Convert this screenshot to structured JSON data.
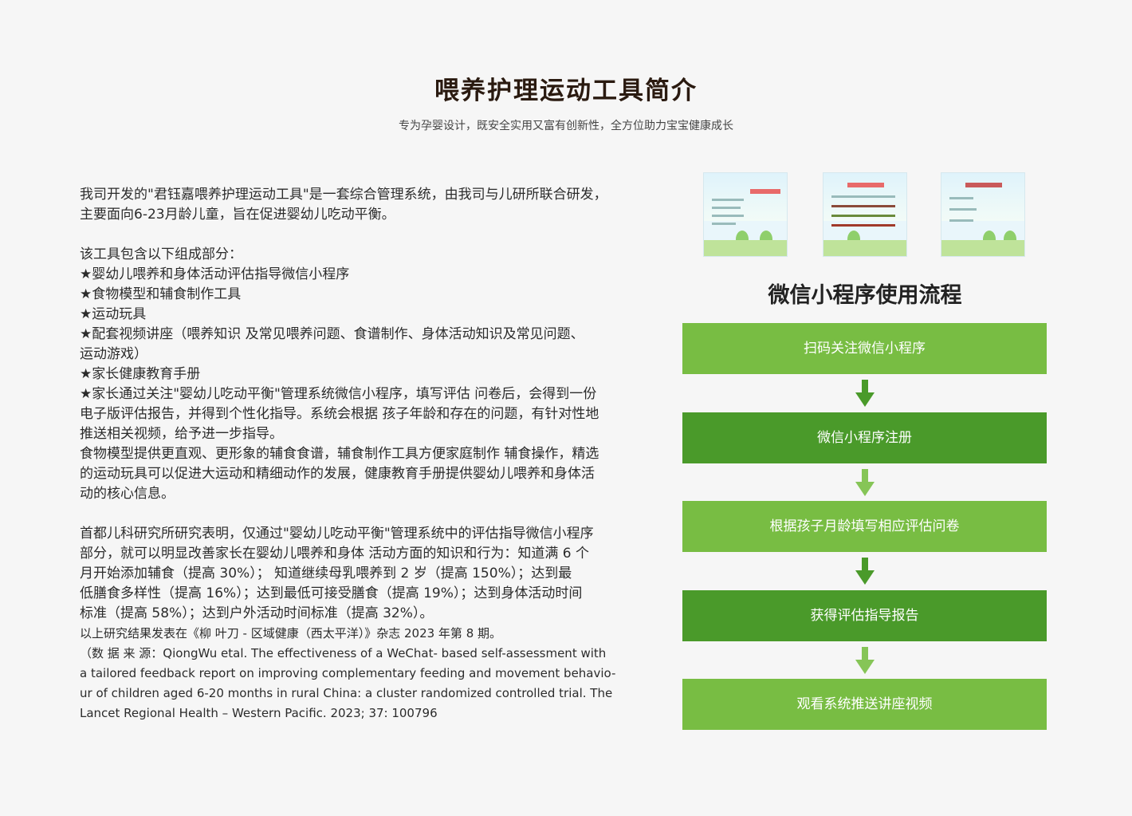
{
  "header": {
    "title": "喂养护理运动工具简介",
    "subtitle": "专为孕婴设计，既安全实用又富有创新性，全方位助力宝宝健康成长"
  },
  "intro": {
    "p1_line1": "我司开发的\"君钰嘉喂养护理运动工具\"是一套综合管理系统，由我司与儿研所联合研发，",
    "p1_line2": "主要面向6-23月龄儿童，旨在促进婴幼儿吃动平衡。",
    "components_heading": "该工具包含以下组成部分：",
    "item1": "★婴幼儿喂养和身体活动评估指导微信小程序",
    "item2": "★食物模型和辅食制作工具",
    "item3": "★运动玩具",
    "item4_line1": "★配套视频讲座（喂养知识  及常见喂养问题、食谱制作、身体活动知识及常见问题、",
    "item4_line2": "运动游戏）",
    "item5": "★家长健康教育手册",
    "item6_line1": "★家长通过关注\"婴幼儿吃动平衡\"管理系统微信小程序，填写评估 问卷后，会得到一份",
    "item6_line2": "电子版评估报告，并得到个性化指导。系统会根据 孩子年龄和存在的问题，有针对性地",
    "item6_line3": "推送相关视频，给予进一步指导。",
    "p2_line1": "食物模型提供更直观、更形象的辅食食谱，辅食制作工具方便家庭制作 辅食操作，精选",
    "p2_line2": "的运动玩具可以促进大运动和精细动作的发展，健康教育手册提供婴幼儿喂养和身体活",
    "p2_line3": "动的核心信息。"
  },
  "research": {
    "line1": "首都儿科研究所研究表明，仅通过\"婴幼儿吃动平衡\"管理系统中的评估指导微信小程序",
    "line2": "部分，就可以明显改善家长在婴幼儿喂养和身体 活动方面的知识和行为：知道满 6 个",
    "line3": "月开始添加辅食（提高 30%）；  知道继续母乳喂养到 2 岁（提高 150%）；达到最",
    "line4": "低膳食多样性（提高 16%）；达到最低可接受膳食（提高 19%）；达到身体活动时间",
    "line5": "标准（提高 58%）；达到户外活动时间标准（提高 32%）。",
    "publication": "以上研究结果发表在《柳 叶刀 - 区域健康（西太平洋）》杂志 2023 年第 8 期。",
    "source_line1": "（数 据 来 源：QiongWu etal. The effectiveness of a WeChat- based self-assessment with",
    "source_line2": " a tailored feedback report on improving complementary feeding and movement behavio-",
    "source_line3": "ur of children aged 6-20 months in rural China: a cluster randomized controlled trial. The",
    "source_line4": " Lancet Regional Health – Western Pacific. 2023; 37: 100796"
  },
  "flow": {
    "title": "微信小程序使用流程",
    "steps": [
      "扫码关注微信小程序",
      "微信小程序注册",
      "根据孩子月龄填写相应评估问卷",
      "获得评估指导报告",
      "观看系统推送讲座视频"
    ],
    "colors": {
      "light_green": "#78bd43",
      "dark_green": "#4a9a2a",
      "arrow_dark": "#4a9a2a",
      "arrow_light": "#86c557"
    }
  }
}
